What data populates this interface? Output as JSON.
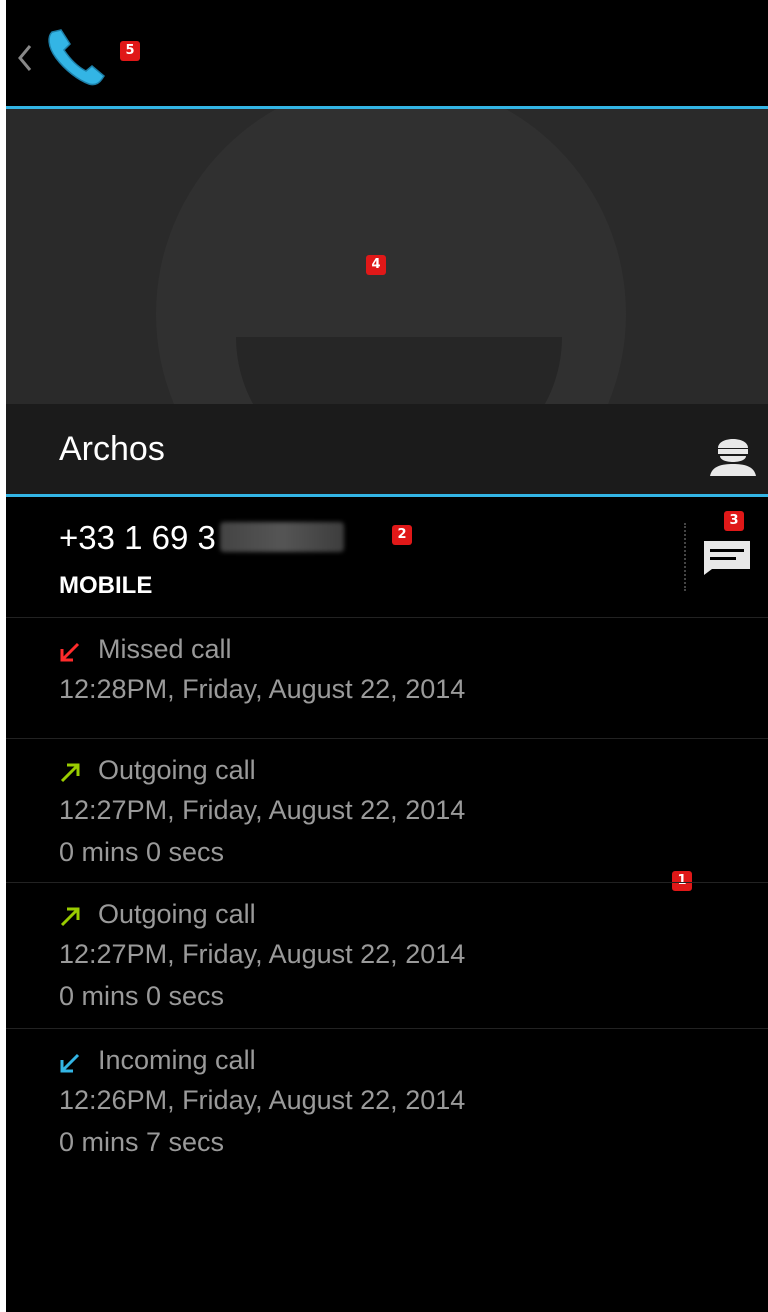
{
  "contact": {
    "name": "Archos",
    "number_visible": "+33 1 69 3",
    "number_type": "MOBILE"
  },
  "icons": {
    "back": "chevron-left-icon",
    "app": "phone-icon",
    "contact": "contact-person-icon",
    "message": "message-icon"
  },
  "calls": [
    {
      "type": "Missed call",
      "time": "12:28PM, Friday, August 22, 2014",
      "duration": "",
      "arrow_color": "#ff2b2b"
    },
    {
      "type": "Outgoing call",
      "time": "12:27PM, Friday, August 22, 2014",
      "duration": "0 mins 0 secs",
      "arrow_color": "#99cc00"
    },
    {
      "type": "Outgoing call",
      "time": "12:27PM, Friday, August 22, 2014",
      "duration": "0 mins 0 secs",
      "arrow_color": "#99cc00"
    },
    {
      "type": "Incoming call",
      "time": "12:26PM, Friday, August 22, 2014",
      "duration": "0 mins 7 secs",
      "arrow_color": "#33b5e5"
    }
  ],
  "badges": [
    "1",
    "2",
    "3",
    "4",
    "5"
  ],
  "colors": {
    "accent": "#33b5e5",
    "missed": "#ff2b2b",
    "outgoing": "#99cc00",
    "incoming": "#33b5e5",
    "badge": "#e01818"
  }
}
